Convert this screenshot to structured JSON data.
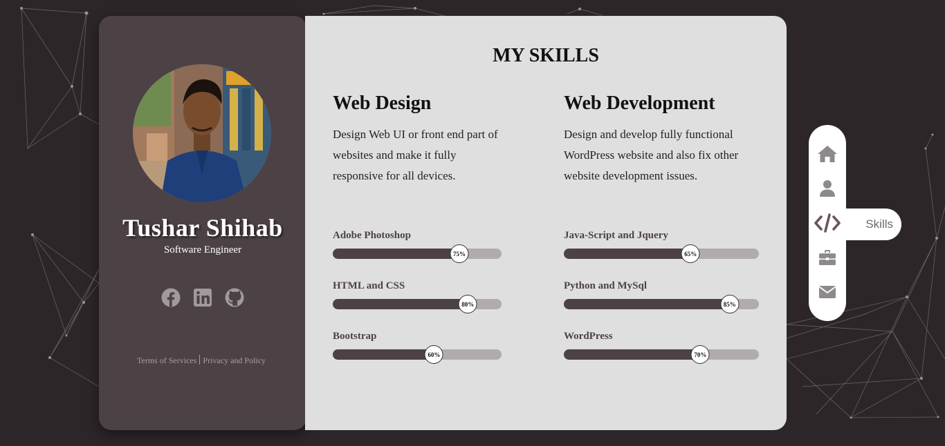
{
  "profile": {
    "name": "Tushar Shihab",
    "title": "Software Engineer",
    "socials": [
      "facebook-icon",
      "linkedin-icon",
      "github-icon"
    ],
    "footer": {
      "terms": "Terms of Services",
      "privacy": "Privacy and Policy"
    }
  },
  "skills": {
    "section_title": "MY SKILLS",
    "categories": [
      {
        "heading": "Web Design",
        "description": "Design Web UI or front end part of websites and make it fully responsive for all devices.",
        "items": [
          {
            "label": "Adobe Photoshop",
            "percent": 75,
            "percent_text": "75%"
          },
          {
            "label": "HTML and CSS",
            "percent": 80,
            "percent_text": "80%"
          },
          {
            "label": "Bootstrap",
            "percent": 60,
            "percent_text": "60%"
          }
        ]
      },
      {
        "heading": "Web Development",
        "description": "Design and develop fully functional WordPress website and also fix other website development issues.",
        "items": [
          {
            "label": "Java-Script and Jquery",
            "percent": 65,
            "percent_text": "65%"
          },
          {
            "label": "Python and MySql",
            "percent": 85,
            "percent_text": "85%"
          },
          {
            "label": "WordPress",
            "percent": 70,
            "percent_text": "70%"
          }
        ]
      }
    ]
  },
  "nav": {
    "items": [
      "home-icon",
      "user-icon",
      "code-icon",
      "briefcase-icon",
      "envelope-icon"
    ],
    "active_tooltip": "Skills"
  },
  "colors": {
    "background": "#2d2629",
    "card_dark": "#4c4245",
    "card_light": "#dfdfdf",
    "bar_track": "#b1abad",
    "nav_icon": "#8e8a8c",
    "nav_icon_active": "#6b5558"
  }
}
